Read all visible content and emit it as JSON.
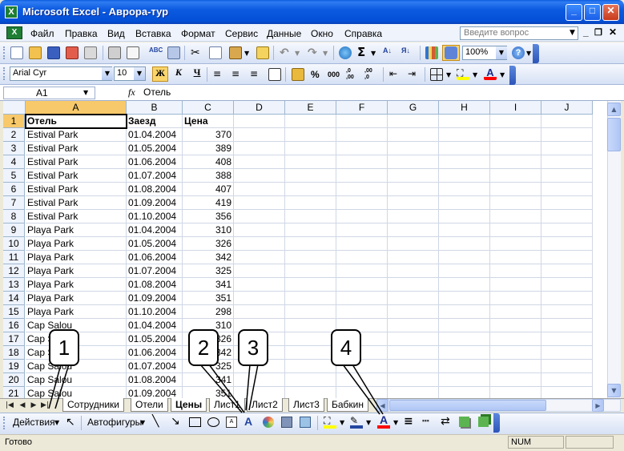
{
  "window": {
    "title": "Microsoft Excel - Аврора-тур",
    "app_icon": "X"
  },
  "menu": {
    "items": [
      "Файл",
      "Правка",
      "Вид",
      "Вставка",
      "Формат",
      "Сервис",
      "Данные",
      "Окно",
      "Справка"
    ],
    "help_placeholder": "Введите вопрос"
  },
  "standard_toolbar": {
    "zoom": "100%"
  },
  "formatting_toolbar": {
    "font": "Arial Cyr",
    "size": "10",
    "bold": "Ж",
    "italic": "К",
    "underline": "Ч",
    "percent": "%",
    "thousands": "000"
  },
  "formula_bar": {
    "name_box": "A1",
    "fx": "fx",
    "content": "Отель"
  },
  "grid": {
    "columns": [
      "A",
      "B",
      "C",
      "D",
      "E",
      "F",
      "G",
      "H",
      "I",
      "J"
    ],
    "selected_column": "A",
    "rows": [
      {
        "n": "1",
        "a": "Отель",
        "b": "Заезд",
        "c": "Цена"
      },
      {
        "n": "2",
        "a": "Estival Park",
        "b": "01.04.2004",
        "c": "370"
      },
      {
        "n": "3",
        "a": "Estival Park",
        "b": "01.05.2004",
        "c": "389"
      },
      {
        "n": "4",
        "a": "Estival Park",
        "b": "01.06.2004",
        "c": "408"
      },
      {
        "n": "5",
        "a": "Estival Park",
        "b": "01.07.2004",
        "c": "388"
      },
      {
        "n": "6",
        "a": "Estival Park",
        "b": "01.08.2004",
        "c": "407"
      },
      {
        "n": "7",
        "a": "Estival Park",
        "b": "01.09.2004",
        "c": "419"
      },
      {
        "n": "8",
        "a": "Estival Park",
        "b": "01.10.2004",
        "c": "356"
      },
      {
        "n": "9",
        "a": "Playa Park",
        "b": "01.04.2004",
        "c": "310"
      },
      {
        "n": "10",
        "a": "Playa Park",
        "b": "01.05.2004",
        "c": "326"
      },
      {
        "n": "11",
        "a": "Playa Park",
        "b": "01.06.2004",
        "c": "342"
      },
      {
        "n": "12",
        "a": "Playa Park",
        "b": "01.07.2004",
        "c": "325"
      },
      {
        "n": "13",
        "a": "Playa Park",
        "b": "01.08.2004",
        "c": "341"
      },
      {
        "n": "14",
        "a": "Playa Park",
        "b": "01.09.2004",
        "c": "351"
      },
      {
        "n": "15",
        "a": "Playa Park",
        "b": "01.10.2004",
        "c": "298"
      },
      {
        "n": "16",
        "a": "Cap Salou",
        "b": "01.04.2004",
        "c": "310"
      },
      {
        "n": "17",
        "a": "Cap Salou",
        "b": "01.05.2004",
        "c": "326"
      },
      {
        "n": "18",
        "a": "Cap Salou",
        "b": "01.06.2004",
        "c": "342"
      },
      {
        "n": "19",
        "a": "Cap Salou",
        "b": "01.07.2004",
        "c": "325"
      },
      {
        "n": "20",
        "a": "Cap Salou",
        "b": "01.08.2004",
        "c": "341"
      },
      {
        "n": "21",
        "a": "Cap Salou",
        "b": "01.09.2004",
        "c": "351"
      }
    ]
  },
  "sheet_tabs": [
    "Сотрудники",
    "Отели",
    "Цены",
    "Лист1",
    "Лист2",
    "Лист3",
    "Бабкин"
  ],
  "active_tab": "Цены",
  "draw_toolbar": {
    "actions": "Действия",
    "autoshapes": "Автофигуры"
  },
  "status": {
    "ready": "Готово",
    "num": "NUM"
  },
  "callouts": [
    "1",
    "2",
    "3",
    "4"
  ],
  "colors": {
    "title_bar": "#0A5BDE",
    "selected_header": "#F8C96B",
    "font_color_bar": "#FF0000",
    "fill_color_bar": "#FFFF00"
  }
}
